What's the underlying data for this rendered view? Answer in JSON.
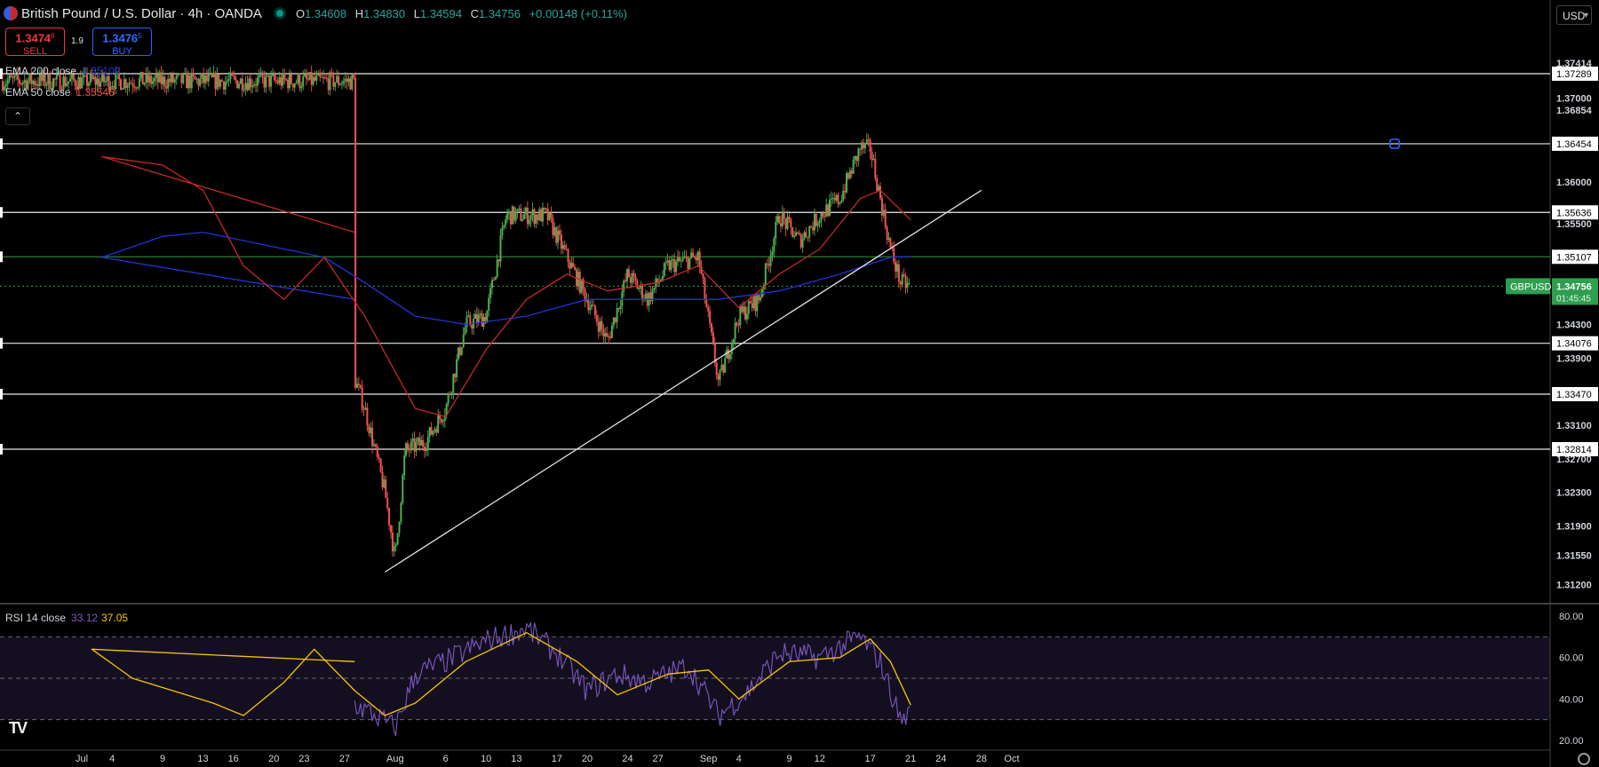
{
  "header": {
    "title": "British Pound / U.S. Dollar · 4h · OANDA",
    "ohlc": {
      "o_label": "O",
      "o": "1.34608",
      "h_label": "H",
      "h": "1.34830",
      "l_label": "L",
      "l": "1.34594",
      "c_label": "C",
      "c": "1.34756",
      "change": "+0.00148 (+0.11%)"
    }
  },
  "trade": {
    "sell_price": "1.3474",
    "sell_sup": "6",
    "sell_label": "SELL",
    "buy_price": "1.3476",
    "buy_sup": "5",
    "buy_label": "BUY",
    "spread": "1.9"
  },
  "indicators": {
    "ema200_label": "EMA 200 close",
    "ema200_value": "1.35109",
    "ema50_label": "EMA 50 close",
    "ema50_value": "1.35546",
    "collapse_icon": "chevron-up-icon"
  },
  "currency_button": {
    "label": "USD"
  },
  "rsi": {
    "label": "RSI 14 close",
    "value": "33.12",
    "ma_value": "37.05"
  },
  "colors": {
    "up": "#4caf50",
    "down": "#ef5350",
    "ema200": "#2432d6",
    "ema50": "#c62828",
    "rsi": "#7e57c2",
    "rsi_ma": "#f7c600",
    "symbol_badge": "#2e9e4f",
    "green_line": "#2e7d32"
  },
  "price_axis": {
    "ticks": [
      "1.37414",
      "1.37000",
      "1.36854",
      "1.36417",
      "1.36000",
      "1.35646",
      "1.35500",
      "1.34300",
      "1.33900",
      "1.33100",
      "1.32700",
      "1.32300",
      "1.31900",
      "1.31550",
      "1.31200"
    ],
    "level_labels": [
      "1.37289",
      "1.36454",
      "1.35636",
      "1.35107",
      "1.34076",
      "1.33470",
      "1.32814"
    ],
    "symbol": "GBPUSD",
    "last_price": "1.34756",
    "countdown": "01:45:45"
  },
  "rsi_axis": {
    "ticks": [
      "80.00",
      "60.00",
      "40.00",
      "20.00"
    ]
  },
  "time_axis": {
    "labels": [
      "Jul",
      "4",
      "9",
      "13",
      "16",
      "20",
      "23",
      "27",
      "Aug",
      "6",
      "10",
      "13",
      "17",
      "20",
      "24",
      "27",
      "Sep",
      "4",
      "9",
      "12",
      "17",
      "21",
      "24",
      "28",
      "Oct"
    ]
  },
  "chart_data": {
    "type": "candlestick",
    "timeframe": "4h",
    "price_range": [
      1.31,
      1.377
    ],
    "horizontal_levels": [
      1.37289,
      1.36454,
      1.35636,
      1.35107,
      1.34076,
      1.3347,
      1.32814
    ],
    "trendline": {
      "from": {
        "date": "Jul 31",
        "price": 1.3135
      },
      "to": {
        "date": "Sep 28",
        "price": 1.359
      }
    },
    "anchors": [
      {
        "d": "Jun 29",
        "p": 1.372
      },
      {
        "d": "Jul 1",
        "p": 1.374
      },
      {
        "d": "Jul 3",
        "p": 1.37
      },
      {
        "d": "Jul 4",
        "p": 1.365
      },
      {
        "d": "Jul 7",
        "p": 1.362
      },
      {
        "d": "Jul 9",
        "p": 1.36
      },
      {
        "d": "Jul 11",
        "p": 1.356
      },
      {
        "d": "Jul 13",
        "p": 1.347
      },
      {
        "d": "Jul 15",
        "p": 1.342
      },
      {
        "d": "Jul 17",
        "p": 1.34
      },
      {
        "d": "Jul 19",
        "p": 1.344
      },
      {
        "d": "Jul 21",
        "p": 1.349
      },
      {
        "d": "Jul 23",
        "p": 1.358
      },
      {
        "d": "Jul 25",
        "p": 1.351
      },
      {
        "d": "Jul 27",
        "p": 1.34
      },
      {
        "d": "Jul 29",
        "p": 1.333
      },
      {
        "d": "Jul 31",
        "p": 1.323
      },
      {
        "d": "Aug 1",
        "p": 1.315
      },
      {
        "d": "Aug 2",
        "p": 1.328
      },
      {
        "d": "Aug 4",
        "p": 1.329
      },
      {
        "d": "Aug 6",
        "p": 1.333
      },
      {
        "d": "Aug 8",
        "p": 1.343
      },
      {
        "d": "Aug 10",
        "p": 1.344
      },
      {
        "d": "Aug 12",
        "p": 1.356
      },
      {
        "d": "Aug 14",
        "p": 1.356
      },
      {
        "d": "Aug 16",
        "p": 1.356
      },
      {
        "d": "Aug 18",
        "p": 1.351
      },
      {
        "d": "Aug 20",
        "p": 1.346
      },
      {
        "d": "Aug 22",
        "p": 1.341
      },
      {
        "d": "Aug 24",
        "p": 1.349
      },
      {
        "d": "Aug 26",
        "p": 1.346
      },
      {
        "d": "Aug 28",
        "p": 1.35
      },
      {
        "d": "Aug 31",
        "p": 1.351
      },
      {
        "d": "Sep 2",
        "p": 1.336
      },
      {
        "d": "Sep 4",
        "p": 1.344
      },
      {
        "d": "Sep 6",
        "p": 1.346
      },
      {
        "d": "Sep 8",
        "p": 1.356
      },
      {
        "d": "Sep 10",
        "p": 1.353
      },
      {
        "d": "Sep 12",
        "p": 1.356
      },
      {
        "d": "Sep 14",
        "p": 1.358
      },
      {
        "d": "Sep 16",
        "p": 1.364
      },
      {
        "d": "Sep 17",
        "p": 1.364
      },
      {
        "d": "Sep 18",
        "p": 1.358
      },
      {
        "d": "Sep 19",
        "p": 1.352
      },
      {
        "d": "Sep 20",
        "p": 1.348
      },
      {
        "d": "Sep 21",
        "p": 1.34756
      }
    ],
    "ema50": [
      {
        "d": "Jun 29",
        "p": 1.354
      },
      {
        "d": "Jul 3",
        "p": 1.363
      },
      {
        "d": "Jul 9",
        "p": 1.362
      },
      {
        "d": "Jul 13",
        "p": 1.359
      },
      {
        "d": "Jul 17",
        "p": 1.35
      },
      {
        "d": "Jul 21",
        "p": 1.346
      },
      {
        "d": "Jul 25",
        "p": 1.351
      },
      {
        "d": "Jul 29",
        "p": 1.344
      },
      {
        "d": "Aug 3",
        "p": 1.333
      },
      {
        "d": "Aug 6",
        "p": 1.332
      },
      {
        "d": "Aug 10",
        "p": 1.34
      },
      {
        "d": "Aug 14",
        "p": 1.346
      },
      {
        "d": "Aug 18",
        "p": 1.349
      },
      {
        "d": "Aug 22",
        "p": 1.347
      },
      {
        "d": "Aug 27",
        "p": 1.348
      },
      {
        "d": "Aug 31",
        "p": 1.35
      },
      {
        "d": "Sep 4",
        "p": 1.345
      },
      {
        "d": "Sep 8",
        "p": 1.349
      },
      {
        "d": "Sep 12",
        "p": 1.352
      },
      {
        "d": "Sep 16",
        "p": 1.358
      },
      {
        "d": "Sep 18",
        "p": 1.359
      },
      {
        "d": "Sep 21",
        "p": 1.35546
      }
    ],
    "ema200": [
      {
        "d": "Jun 29",
        "p": 1.346
      },
      {
        "d": "Jul 3",
        "p": 1.351
      },
      {
        "d": "Jul 9",
        "p": 1.3535
      },
      {
        "d": "Jul 13",
        "p": 1.354
      },
      {
        "d": "Jul 19",
        "p": 1.3525
      },
      {
        "d": "Jul 25",
        "p": 1.351
      },
      {
        "d": "Jul 29",
        "p": 1.348
      },
      {
        "d": "Aug 3",
        "p": 1.344
      },
      {
        "d": "Aug 8",
        "p": 1.343
      },
      {
        "d": "Aug 14",
        "p": 1.344
      },
      {
        "d": "Aug 20",
        "p": 1.346
      },
      {
        "d": "Aug 27",
        "p": 1.346
      },
      {
        "d": "Sep 2",
        "p": 1.346
      },
      {
        "d": "Sep 8",
        "p": 1.347
      },
      {
        "d": "Sep 14",
        "p": 1.349
      },
      {
        "d": "Sep 19",
        "p": 1.351
      },
      {
        "d": "Sep 21",
        "p": 1.35109
      }
    ],
    "rsi_range": [
      20,
      80
    ],
    "rsi_bands": [
      70,
      50,
      30
    ],
    "rsi_anchors": [
      {
        "d": "Jun 29",
        "v": 62
      },
      {
        "d": "Jul 1",
        "v": 72
      },
      {
        "d": "Jul 4",
        "v": 48
      },
      {
        "d": "Jul 7",
        "v": 44
      },
      {
        "d": "Jul 11",
        "v": 46
      },
      {
        "d": "Jul 15",
        "v": 28
      },
      {
        "d": "Jul 17",
        "v": 30
      },
      {
        "d": "Jul 21",
        "v": 55
      },
      {
        "d": "Jul 24",
        "v": 68
      },
      {
        "d": "Jul 27",
        "v": 40
      },
      {
        "d": "Jul 30",
        "v": 32
      },
      {
        "d": "Aug 1",
        "v": 26
      },
      {
        "d": "Aug 3",
        "v": 52
      },
      {
        "d": "Aug 6",
        "v": 58
      },
      {
        "d": "Aug 10",
        "v": 68
      },
      {
        "d": "Aug 14",
        "v": 74
      },
      {
        "d": "Aug 17",
        "v": 62
      },
      {
        "d": "Aug 20",
        "v": 44
      },
      {
        "d": "Aug 23",
        "v": 52
      },
      {
        "d": "Aug 26",
        "v": 48
      },
      {
        "d": "Aug 30",
        "v": 56
      },
      {
        "d": "Sep 2",
        "v": 32
      },
      {
        "d": "Sep 5",
        "v": 44
      },
      {
        "d": "Sep 8",
        "v": 62
      },
      {
        "d": "Sep 12",
        "v": 60
      },
      {
        "d": "Sep 16",
        "v": 70
      },
      {
        "d": "Sep 18",
        "v": 58
      },
      {
        "d": "Sep 20",
        "v": 30
      },
      {
        "d": "Sep 21",
        "v": 33.12
      }
    ],
    "rsi_ma_anchors": [
      {
        "d": "Jun 29",
        "v": 58
      },
      {
        "d": "Jul 2",
        "v": 64
      },
      {
        "d": "Jul 6",
        "v": 50
      },
      {
        "d": "Jul 10",
        "v": 44
      },
      {
        "d": "Jul 14",
        "v": 38
      },
      {
        "d": "Jul 17",
        "v": 32
      },
      {
        "d": "Jul 21",
        "v": 48
      },
      {
        "d": "Jul 24",
        "v": 64
      },
      {
        "d": "Jul 28",
        "v": 44
      },
      {
        "d": "Jul 31",
        "v": 32
      },
      {
        "d": "Aug 3",
        "v": 38
      },
      {
        "d": "Aug 8",
        "v": 58
      },
      {
        "d": "Aug 14",
        "v": 72
      },
      {
        "d": "Aug 19",
        "v": 58
      },
      {
        "d": "Aug 23",
        "v": 42
      },
      {
        "d": "Aug 28",
        "v": 52
      },
      {
        "d": "Sep 1",
        "v": 54
      },
      {
        "d": "Sep 4",
        "v": 40
      },
      {
        "d": "Sep 9",
        "v": 58
      },
      {
        "d": "Sep 14",
        "v": 60
      },
      {
        "d": "Sep 17",
        "v": 69
      },
      {
        "d": "Sep 19",
        "v": 58
      },
      {
        "d": "Sep 21",
        "v": 37.05
      }
    ]
  }
}
